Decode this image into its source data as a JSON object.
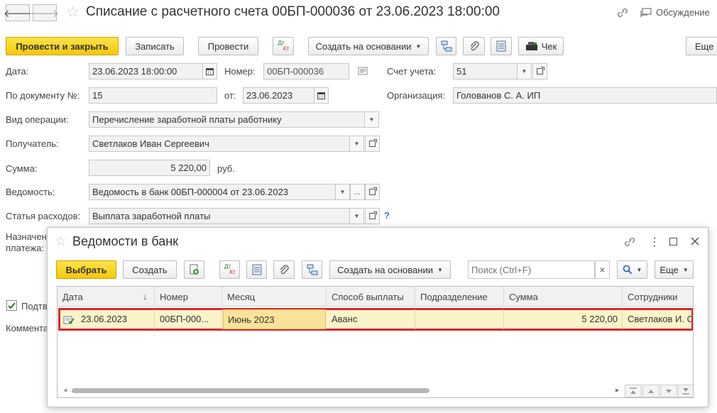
{
  "window": {
    "title": "Списание с расчетного счета 00БП-000036 от 23.06.2023 18:00:00",
    "back_glyph": "🡐",
    "forward_glyph": "🡒",
    "star_glyph": "☆",
    "discussion_label": "Обсуждение"
  },
  "toolbar": {
    "post_and_close": "Провести и закрыть",
    "save": "Записать",
    "post": "Провести",
    "create_based_on": "Создать на основании",
    "check": "Чек",
    "more": "Еще",
    "dtkt_top": "Дт",
    "dtkt_bottom": "Кт"
  },
  "form": {
    "date_label": "Дата:",
    "date_value": "23.06.2023 18:00:00",
    "number_label": "Номер:",
    "number_value": "00БП-000036",
    "account_label": "Счет учета:",
    "account_value": "51",
    "doc_no_label": "По документу №:",
    "doc_no_value": "15",
    "from_label": "от:",
    "from_value": "23.06.2023",
    "org_label": "Организация:",
    "org_value": "Голованов С. А. ИП",
    "operation_label": "Вид операции:",
    "operation_value": "Перечисление заработной платы работнику",
    "recipient_label": "Получатель:",
    "recipient_value": "Светлаков Иван Сергеевич",
    "sum_label": "Сумма:",
    "sum_value": "5 220,00",
    "currency": "руб.",
    "statement_label": "Ведомость:",
    "statement_value": "Ведомость в банк 00БП-000004 от 23.06.2023",
    "expense_label": "Статья расходов:",
    "expense_value": "Выплата заработной платы",
    "help": "?",
    "purpose_label_1": "Назначен",
    "purpose_label_2": "платежа:",
    "confirm_label": "Подтв",
    "comment_label": "Коммента",
    "ellipsis": "..."
  },
  "dialog": {
    "title": "Ведомости в банк",
    "select": "Выбрать",
    "create": "Создать",
    "create_based_on": "Создать на основании",
    "search_placeholder": "Поиск (Ctrl+F)",
    "clear": "×",
    "more": "Еще",
    "menu_dots": "⋮",
    "columns": [
      "Дата",
      "Номер",
      "Месяц",
      "Способ выплаты",
      "Подразделение",
      "Сумма",
      "Сотрудники"
    ],
    "sort_glyph": "↓",
    "rows": [
      {
        "date": "23.06.2023",
        "number": "00БП-000...",
        "month": "Июнь 2023",
        "method": "Аванс",
        "department": "",
        "sum": "5 220,00",
        "employees": "Светлаков И. С."
      }
    ]
  },
  "colors": {
    "accent_yellow": "#f5cd1f",
    "row_highlight": "#fbf3c9",
    "selected_cell": "#f9e39a",
    "row_border": "#d9272e"
  }
}
